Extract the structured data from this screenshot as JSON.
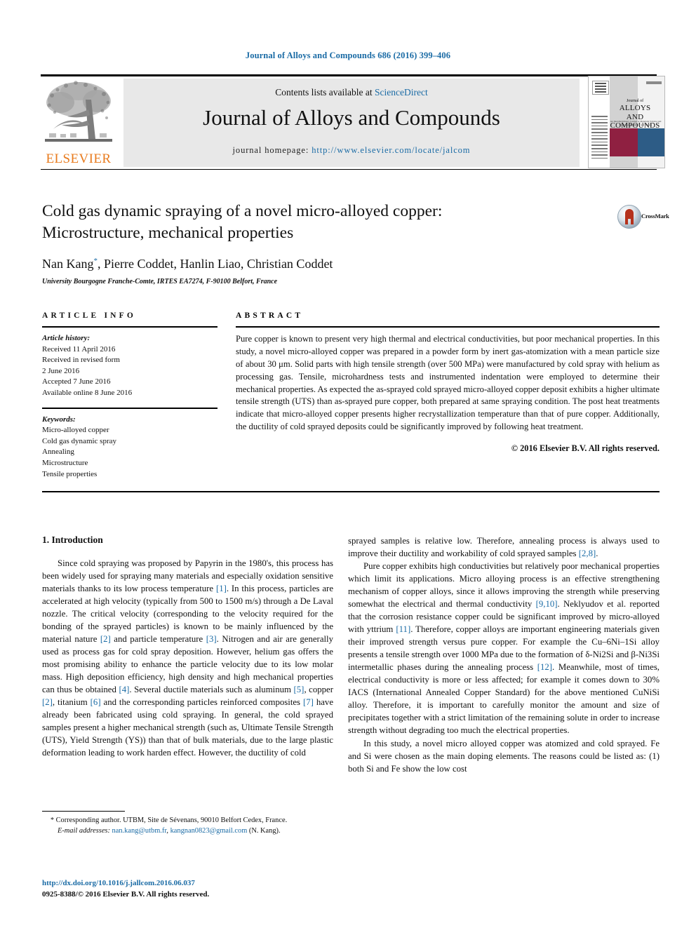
{
  "running_head": "Journal of Alloys and Compounds 686 (2016) 399–406",
  "masthead": {
    "publisher": "ELSEVIER",
    "contents_prefix": "Contents lists available at ",
    "contents_link": "ScienceDirect",
    "journal_title": "Journal of Alloys and Compounds",
    "homepage_label": "journal homepage: ",
    "homepage_url": "http://www.elsevier.com/locate/jalcom",
    "cover": {
      "line1": "Journal of",
      "line2": "ALLOYS",
      "line3": "AND COMPOUNDS",
      "subtitle": "An Interdisciplinary Journal of Materials Science and Solid-state Chemistry and Physics"
    }
  },
  "article": {
    "title_line1": "Cold gas dynamic spraying of a novel micro-alloyed copper:",
    "title_line2": "Microstructure, mechanical properties",
    "authors": "Nan Kang",
    "authors_rest": ", Pierre Coddet, Hanlin Liao, Christian Coddet",
    "corresponding_marker": "*",
    "affiliation": "University Bourgogne Franche-Comte, IRTES EA7274, F-90100 Belfort, France",
    "crossmark_label": "CrossMark"
  },
  "info": {
    "heading": "ARTICLE INFO",
    "history_label": "Article history:",
    "history": [
      "Received 11 April 2016",
      "Received in revised form",
      "2 June 2016",
      "Accepted 7 June 2016",
      "Available online 8 June 2016"
    ],
    "keywords_label": "Keywords:",
    "keywords": [
      "Micro-alloyed copper",
      "Cold gas dynamic spray",
      "Annealing",
      "Microstructure",
      "Tensile properties"
    ]
  },
  "abstract": {
    "heading": "ABSTRACT",
    "text": "Pure copper is known to present very high thermal and electrical conductivities, but poor mechanical properties. In this study, a novel micro-alloyed copper was prepared in a powder form by inert gas-atomization with a mean particle size of about 30 μm. Solid parts with high tensile strength (over 500 MPa) were manufactured by cold spray with helium as processing gas. Tensile, microhardness tests and instrumented indentation were employed to determine their mechanical properties. As expected the as-sprayed cold sprayed micro-alloyed copper deposit exhibits a higher ultimate tensile strength (UTS) than as-sprayed pure copper, both prepared at same spraying condition. The post heat treatments indicate that micro-alloyed copper presents higher recrystallization temperature than that of pure copper. Additionally, the ductility of cold sprayed deposits could be significantly improved by following heat treatment.",
    "copyright": "© 2016 Elsevier B.V. All rights reserved."
  },
  "body": {
    "section_title": "1. Introduction",
    "left_paragraphs": [
      "Since cold spraying was proposed by Papyrin in the 1980's, this process has been widely used for spraying many materials and especially oxidation sensitive materials thanks to its low process temperature [1]. In this process, particles are accelerated at high velocity (typically from 500 to 1500 m/s) through a De Laval nozzle. The critical velocity (corresponding to the velocity required for the bonding of the sprayed particles) is known to be mainly influenced by the material nature [2] and particle temperature [3]. Nitrogen and air are generally used as process gas for cold spray deposition. However, helium gas offers the most promising ability to enhance the particle velocity due to its low molar mass. High deposition efficiency, high density and high mechanical properties can thus be obtained [4]. Several ductile materials such as aluminum [5], copper [2], titanium [6] and the corresponding particles reinforced composites [7] have already been fabricated using cold spraying. In general, the cold sprayed samples present a higher mechanical strength (such as, Ultimate Tensile Strength (UTS), Yield Strength (YS)) than that of bulk materials, due to the large plastic deformation leading to work harden effect. However, the ductility of cold"
    ],
    "right_paragraphs": [
      "sprayed samples is relative low. Therefore, annealing process is always used to improve their ductility and workability of cold sprayed samples [2,8].",
      "Pure copper exhibits high conductivities but relatively poor mechanical properties which limit its applications. Micro alloying process is an effective strengthening mechanism of copper alloys, since it allows improving the strength while preserving somewhat the electrical and thermal conductivity [9,10]. Neklyudov et al. reported that the corrosion resistance copper could be significant improved by micro-alloyed with yttrium [11]. Therefore, copper alloys are important engineering materials given their improved strength versus pure copper. For example the Cu–6Ni–1Si alloy presents a tensile strength over 1000 MPa due to the formation of δ-Ni2Si and β-Ni3Si intermetallic phases during the annealing process [12]. Meanwhile, most of times, electrical conductivity is more or less affected; for example it comes down to 30% IACS (International Annealed Copper Standard) for the above mentioned CuNiSi alloy. Therefore, it is important to carefully monitor the amount and size of precipitates together with a strict limitation of the remaining solute in order to increase strength without degrading too much the electrical properties.",
      "In this study, a novel micro alloyed copper was atomized and cold sprayed. Fe and Si were chosen as the main doping elements. The reasons could be listed as: (1) both Si and Fe show the low cost"
    ]
  },
  "footnote": {
    "corresponding": "Corresponding author. UTBM, Site de Sévenans, 90010 Belfort Cedex, France.",
    "email_label": "E-mail addresses:",
    "email1": "nan.kang@utbm.fr",
    "email2": "kangnan0823@gmail.com",
    "email_suffix": "(N. Kang)."
  },
  "imprint": {
    "doi": "http://dx.doi.org/10.1016/j.jallcom.2016.06.037",
    "issn_line": "0925-8388/© 2016 Elsevier B.V. All rights reserved."
  },
  "colors": {
    "link_blue": "#1a6ba5",
    "elsevier_orange": "#e87b1e",
    "cover_red": "#8f2041",
    "cover_blue": "#2d5c86",
    "crossmark_red": "#b5321d"
  }
}
